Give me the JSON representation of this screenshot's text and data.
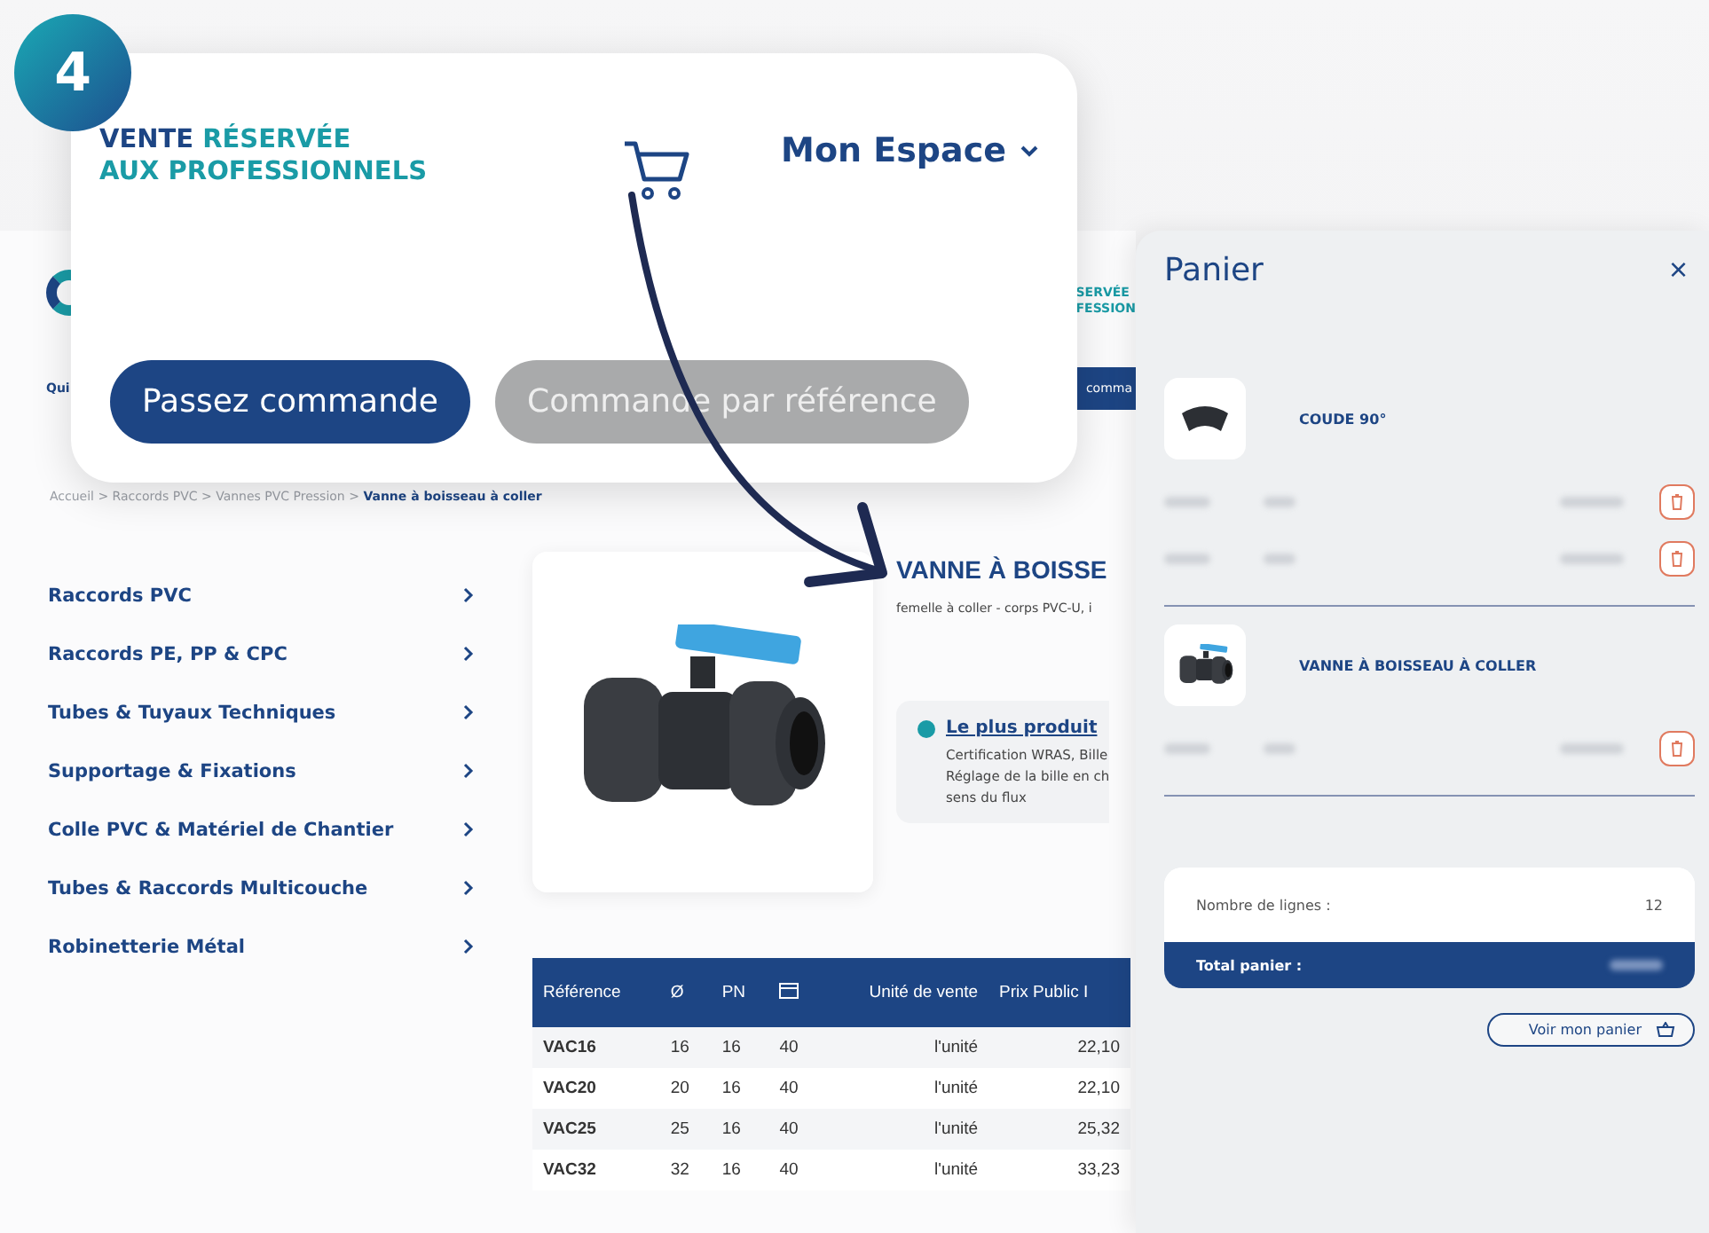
{
  "step_badge": "4",
  "overlay_card": {
    "tagline": {
      "lead": "VENTE",
      "accent": "RÉSERVÉE",
      "second_line": "AUX PROFESSIONNELS"
    },
    "account": "Mon Espace",
    "buttons": [
      {
        "label": "Passez commande",
        "disabled": false
      },
      {
        "label": "Commande par référence",
        "disabled": true
      }
    ]
  },
  "header": {
    "tagline_lines": [
      "SERVÉE",
      "FESSION"
    ],
    "nav_left": "Qui",
    "nav_button": "comma"
  },
  "breadcrumb": "Accueil > Raccords PVC > Vannes PVC Pression > **Vanne à boisseau à coller**",
  "categories": [
    "Raccords PVC",
    "Raccords PE, PP & CPC",
    "Tubes & Tuyaux Techniques",
    "Supportage & Fixations",
    "Colle PVC & Matériel de Chantier",
    "Tubes & Raccords Multicouche",
    "Robinetterie Métal"
  ],
  "product": {
    "title": "VANNE À BOISSE",
    "subtitle": "femelle à coller - corps PVC-U, i",
    "feature": {
      "title": "Le plus produit",
      "lines": [
        "Certification WRAS, Bille",
        "Réglage de la bille en ch",
        "sens du flux"
      ]
    }
  },
  "table": {
    "columns": [
      {
        "kind": "text",
        "label": "Référence"
      },
      {
        "kind": "text",
        "label": "Ø"
      },
      {
        "kind": "text",
        "label": "PN"
      },
      {
        "kind": "icon"
      },
      {
        "kind": "text",
        "label": "Unité de vente"
      },
      {
        "kind": "text",
        "label": "Prix Public I"
      }
    ],
    "rows": [
      [
        "VAC16",
        "16",
        "16",
        "40",
        "l'unité",
        "22,10"
      ],
      [
        "VAC20",
        "20",
        "16",
        "40",
        "l'unité",
        "22,10"
      ],
      [
        "VAC25",
        "25",
        "16",
        "40",
        "l'unité",
        "25,32"
      ],
      [
        "VAC32",
        "32",
        "16",
        "40",
        "l'unité",
        "33,23"
      ]
    ]
  },
  "cart": {
    "title": "Panier",
    "close": "×",
    "items": [
      {
        "kind": "elbow",
        "name": "COUDE 90°",
        "lines": [
          {
            "kind": "blurred"
          },
          {
            "kind": "blurred"
          }
        ]
      },
      {
        "kind": "valve",
        "name": "VANNE À BOISSEAU À COLLER",
        "lines": [
          {
            "kind": "blurred"
          }
        ]
      }
    ],
    "summary": {
      "lines_label": "Nombre de lignes :",
      "lines_value": "12",
      "total_label": "Total panier :"
    },
    "view_button": "Voir mon panier"
  }
}
